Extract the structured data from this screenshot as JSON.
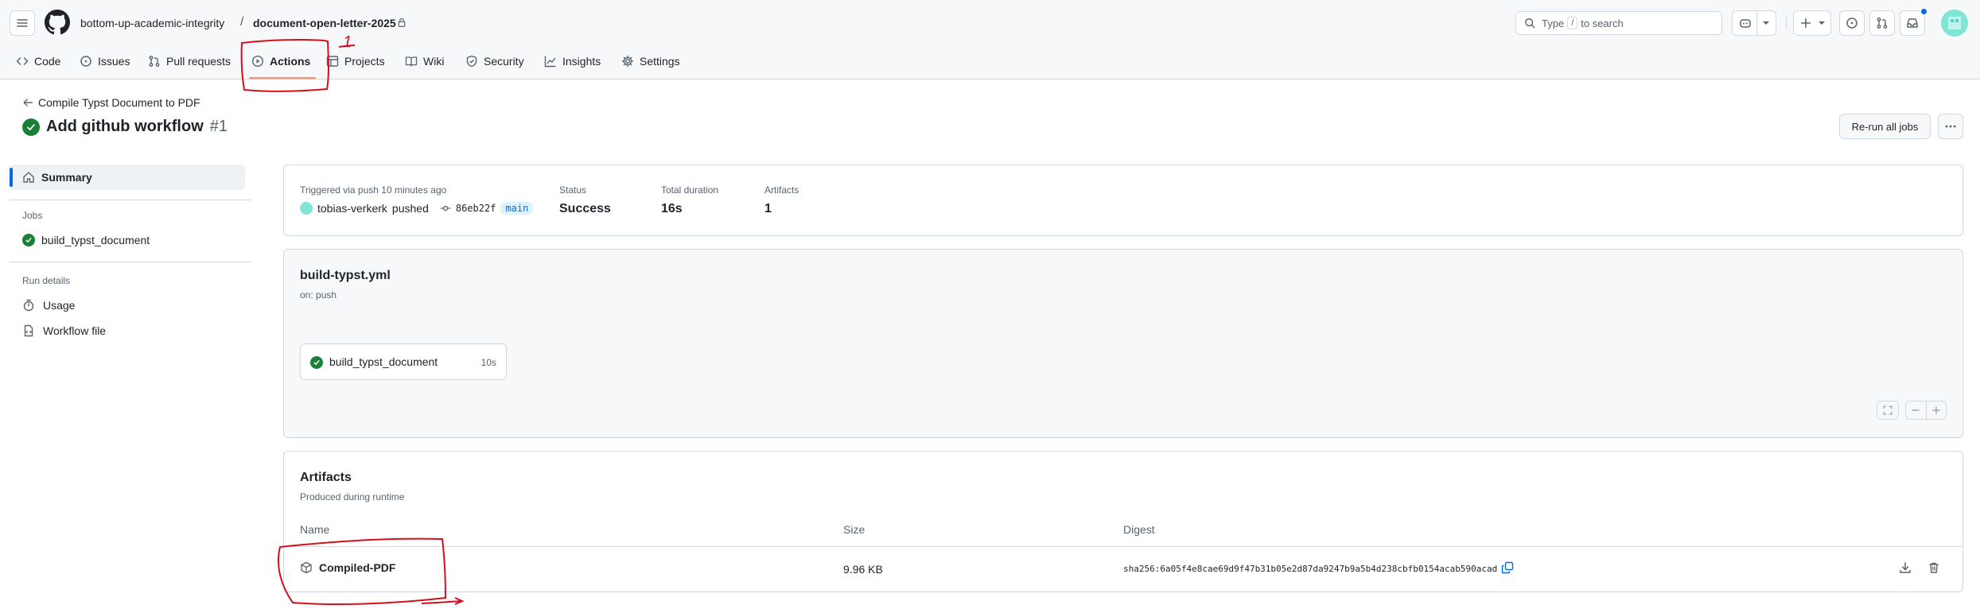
{
  "header": {
    "owner": "bottom-up-academic-integrity",
    "separator": "/",
    "repo": "document-open-letter-2025",
    "search_prefix": "Type",
    "search_key": "/",
    "search_suffix": "to search"
  },
  "tabs": [
    {
      "label": "Code",
      "icon": "code-icon"
    },
    {
      "label": "Issues",
      "icon": "issue-icon"
    },
    {
      "label": "Pull requests",
      "icon": "pull-request-icon"
    },
    {
      "label": "Actions",
      "icon": "play-icon"
    },
    {
      "label": "Projects",
      "icon": "table-icon"
    },
    {
      "label": "Wiki",
      "icon": "book-icon"
    },
    {
      "label": "Security",
      "icon": "shield-icon"
    },
    {
      "label": "Insights",
      "icon": "graph-icon"
    },
    {
      "label": "Settings",
      "icon": "gear-icon"
    }
  ],
  "annotation": {
    "number": "1"
  },
  "run": {
    "back_link": "Compile Typst Document to PDF",
    "title": "Add github workflow",
    "number": "#1",
    "rerun_label": "Re-run all jobs",
    "more_label": "···"
  },
  "sidebar": {
    "summary": "Summary",
    "jobs_heading": "Jobs",
    "job": "build_typst_document",
    "run_details_heading": "Run details",
    "usage": "Usage",
    "workflow_file": "Workflow file"
  },
  "summary": {
    "triggered": "Triggered via push 10 minutes ago",
    "user": "tobias-verkerk",
    "pushed": "pushed",
    "commit": "86eb22f",
    "branch": "main",
    "status_label": "Status",
    "status_value": "Success",
    "duration_label": "Total duration",
    "duration_value": "16s",
    "artifacts_label": "Artifacts",
    "artifacts_value": "1"
  },
  "workflow": {
    "file": "build-typst.yml",
    "trigger": "on: push",
    "job": "build_typst_document",
    "job_duration": "10s"
  },
  "artifacts": {
    "title": "Artifacts",
    "subtitle": "Produced during runtime",
    "col_name": "Name",
    "col_size": "Size",
    "col_digest": "Digest",
    "row": {
      "name": "Compiled-PDF",
      "size": "9.96 KB",
      "digest": "sha256:6a05f4e8cae69d9f47b31b05e2d87da9247b9a5b4d238cbfb0154acab590acad"
    }
  },
  "colors": {
    "success": "#1a7f37",
    "annotation": "#d4101e",
    "tab_underline": "#fd8c73",
    "accent": "#0969da"
  }
}
